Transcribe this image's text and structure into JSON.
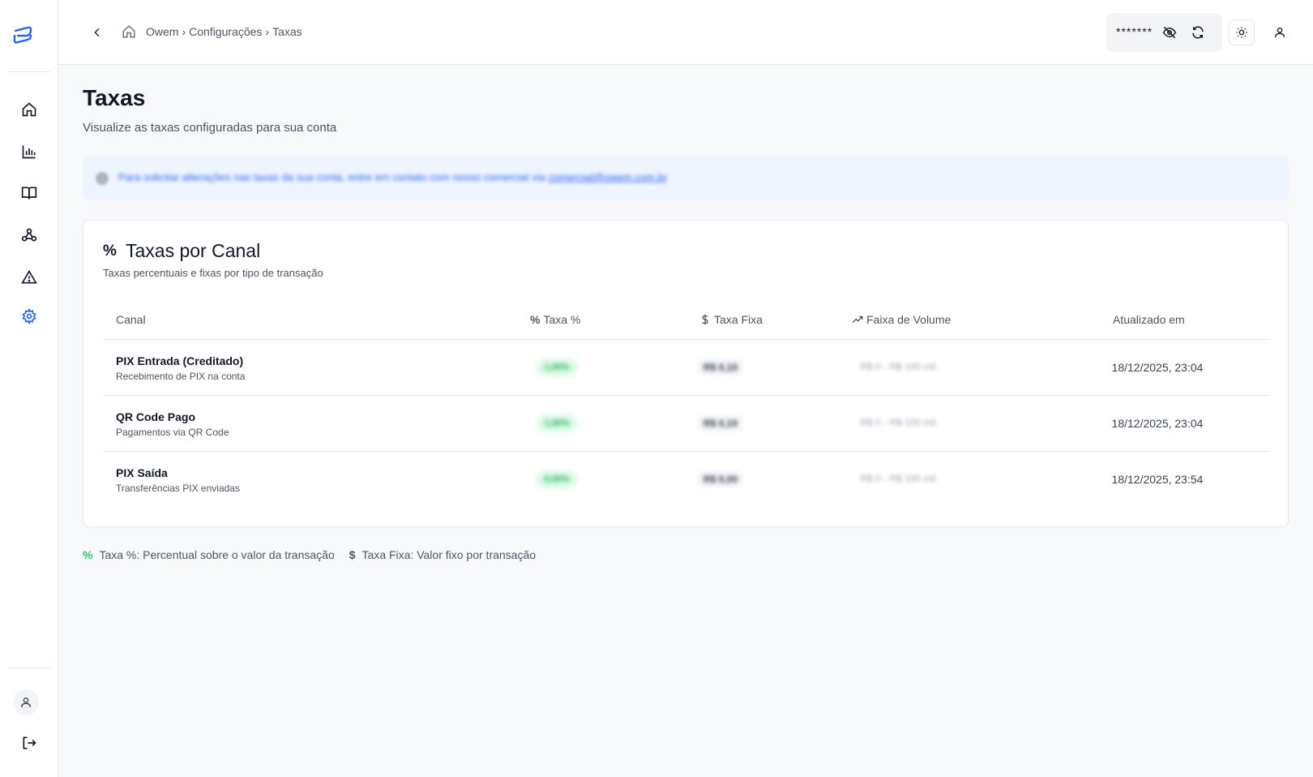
{
  "header": {
    "breadcrumb": [
      "Owem",
      "›",
      "Configurações",
      "›",
      "Taxas"
    ],
    "balance_masked": "*******"
  },
  "page": {
    "title": "Taxas",
    "subtitle": "Visualize as taxas configuradas para sua conta"
  },
  "notice": {
    "text": "Para solicitar alterações nas taxas da sua conta, entre em contato com nosso comercial via",
    "email": "comercial@owem.com.br"
  },
  "card": {
    "title_icon": "%",
    "title": "Taxas por Canal",
    "subtitle": "Taxas percentuais e fixas por tipo de transação",
    "columns": {
      "canal": "Canal",
      "taxa_pct": "Taxa %",
      "taxa_fixa": "Taxa Fixa",
      "faixa": "Faixa de Volume",
      "atualizado": "Atualizado em"
    },
    "rows": [
      {
        "name": "PIX Entrada (Creditado)",
        "desc": "Recebimento de PIX na conta",
        "pct": "1,00%",
        "fixed": "R$ 0,10",
        "volume": "R$ 0 - R$ 100 mil",
        "updated": "18/12/2025, 23:04"
      },
      {
        "name": "QR Code Pago",
        "desc": "Pagamentos via QR Code",
        "pct": "1,00%",
        "fixed": "R$ 0,10",
        "volume": "R$ 0 - R$ 100 mil",
        "updated": "18/12/2025, 23:04"
      },
      {
        "name": "PIX Saída",
        "desc": "Transferências PIX enviadas",
        "pct": "0,00%",
        "fixed": "R$ 0,00",
        "volume": "R$ 0 - R$ 100 mil",
        "updated": "18/12/2025, 23:54"
      }
    ]
  },
  "legend": {
    "pct_symbol": "%",
    "pct_text": "Taxa %: Percentual sobre o valor da transação",
    "usd_symbol": "$",
    "usd_text": "Taxa Fixa: Valor fixo por transação"
  },
  "colors": {
    "accent": "#2563eb",
    "success": "#22c55e",
    "background": "#f8f9fb"
  },
  "icons": [
    "logo-icon",
    "home-icon",
    "chart-icon",
    "book-icon",
    "webhook-icon",
    "alert-icon",
    "settings-icon",
    "user-icon",
    "logout-icon",
    "back-icon",
    "eye-off-icon",
    "refresh-icon",
    "sun-icon",
    "trending-up-icon",
    "dollar-icon",
    "percent-icon"
  ]
}
